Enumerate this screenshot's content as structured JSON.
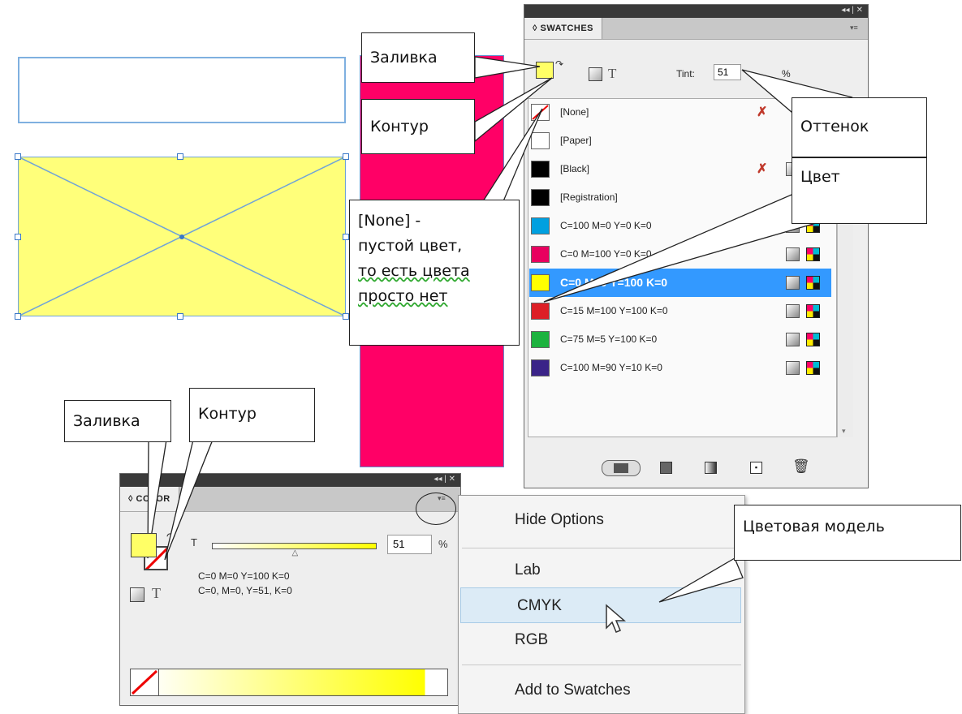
{
  "swatches": {
    "title": "SWATCHES",
    "tint_label": "Tint:",
    "tint_value": "51",
    "percent": "%",
    "text_glyph": "T",
    "items": [
      {
        "name": "[None]",
        "color": "none"
      },
      {
        "name": "[Paper]",
        "color": "#ffffff"
      },
      {
        "name": "[Black]",
        "color": "#000000"
      },
      {
        "name": "[Registration]",
        "color": "#000000"
      },
      {
        "name": "C=100 M=0 Y=0 K=0",
        "color": "#00a0e0"
      },
      {
        "name": "C=0 M=100 Y=0 K=0",
        "color": "#e8005f"
      },
      {
        "name": "C=0 M=0 Y=100 K=0",
        "color": "#ffff00"
      },
      {
        "name": "C=15 M=100 Y=100 K=0",
        "color": "#dd1f26"
      },
      {
        "name": "C=75 M=5 Y=100 K=0",
        "color": "#1db33f"
      },
      {
        "name": "C=100 M=90 Y=10 K=0",
        "color": "#3a2388"
      }
    ],
    "selected_index": 6
  },
  "color_panel": {
    "title": "OLOR",
    "title_prefix": "◊ C",
    "tint_label": "T",
    "tint_value": "51",
    "percent": "%",
    "tint_level": 0.51,
    "line1": "C=0 M=0 Y=100 K=0",
    "line2": "C=0, M=0, Y=51, K=0",
    "text_glyph": "T"
  },
  "menu": {
    "items": [
      "Hide Options",
      "Lab",
      "CMYK",
      "RGB",
      "Add to Swatches"
    ],
    "highlighted": "CMYK"
  },
  "callouts": {
    "fill_top": "Заливка",
    "stroke_top": "Контур",
    "none_desc": [
      "[None] -",
      "пустой цвет,",
      "то есть цвета",
      "просто нет"
    ],
    "tint": "Оттенок",
    "color": "Цвет",
    "fill_bottom": "Заливка",
    "stroke_bottom": "Контур",
    "color_model": "Цветовая модель"
  },
  "colors": {
    "accent_selection": "#3399ff",
    "fill_yellow": "#ffff7a",
    "magenta": "#ff0066"
  }
}
